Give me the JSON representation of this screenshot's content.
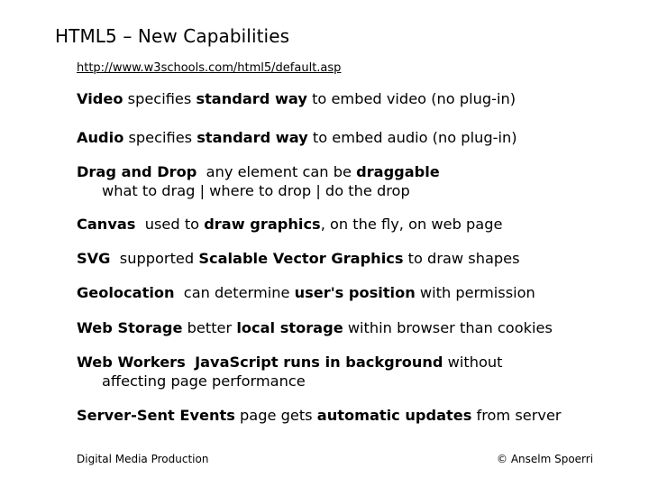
{
  "slide": {
    "title": "HTML5 – New Capabilities",
    "link": "http://www.w3schools.com/html5/default.asp",
    "items": [
      {
        "parts": [
          {
            "text": "Video",
            "bold": true
          },
          {
            "text": " specifies ",
            "bold": false
          },
          {
            "text": "standard way",
            "bold": true
          },
          {
            "text": " to embed video (no plug-in)",
            "bold": false
          }
        ],
        "sub": ""
      },
      {
        "parts": [
          {
            "text": "Audio",
            "bold": true
          },
          {
            "text": " specifies ",
            "bold": false
          },
          {
            "text": "standard way",
            "bold": true
          },
          {
            "text": " to embed audio (no plug-in)",
            "bold": false
          }
        ],
        "sub": ""
      },
      {
        "parts": [
          {
            "text": "Drag and Drop",
            "bold": true
          },
          {
            "text": "  any element can be ",
            "bold": false
          },
          {
            "text": "draggable",
            "bold": true
          }
        ],
        "sub": "what to drag | where to drop | do the drop"
      },
      {
        "parts": [
          {
            "text": "Canvas",
            "bold": true
          },
          {
            "text": "  used to ",
            "bold": false
          },
          {
            "text": "draw graphics",
            "bold": true
          },
          {
            "text": ", on the fly, on web page",
            "bold": false
          }
        ],
        "sub": ""
      },
      {
        "parts": [
          {
            "text": "SVG",
            "bold": true
          },
          {
            "text": "  supported ",
            "bold": false
          },
          {
            "text": "Scalable Vector Graphics",
            "bold": true
          },
          {
            "text": " to draw shapes",
            "bold": false
          }
        ],
        "sub": ""
      },
      {
        "parts": [
          {
            "text": "Geolocation",
            "bold": true
          },
          {
            "text": "  can determine ",
            "bold": false
          },
          {
            "text": "user's position",
            "bold": true
          },
          {
            "text": " with permission",
            "bold": false
          }
        ],
        "sub": ""
      },
      {
        "parts": [
          {
            "text": "Web Storage",
            "bold": true
          },
          {
            "text": " better ",
            "bold": false
          },
          {
            "text": "local storage",
            "bold": true
          },
          {
            "text": " within browser than cookies",
            "bold": false
          }
        ],
        "sub": ""
      },
      {
        "parts": [
          {
            "text": "Web Workers",
            "bold": true
          },
          {
            "text": "  ",
            "bold": false
          },
          {
            "text": "JavaScript runs in background",
            "bold": true
          },
          {
            "text": " without",
            "bold": false
          }
        ],
        "sub": "affecting page performance"
      },
      {
        "parts": [
          {
            "text": "Server-Sent Events",
            "bold": true
          },
          {
            "text": " page gets ",
            "bold": false
          },
          {
            "text": "automatic updates",
            "bold": true
          },
          {
            "text": " from server",
            "bold": false
          }
        ],
        "sub": ""
      }
    ]
  },
  "footer": {
    "left": "Digital Media Production",
    "right": "© Anselm Spoerri"
  }
}
